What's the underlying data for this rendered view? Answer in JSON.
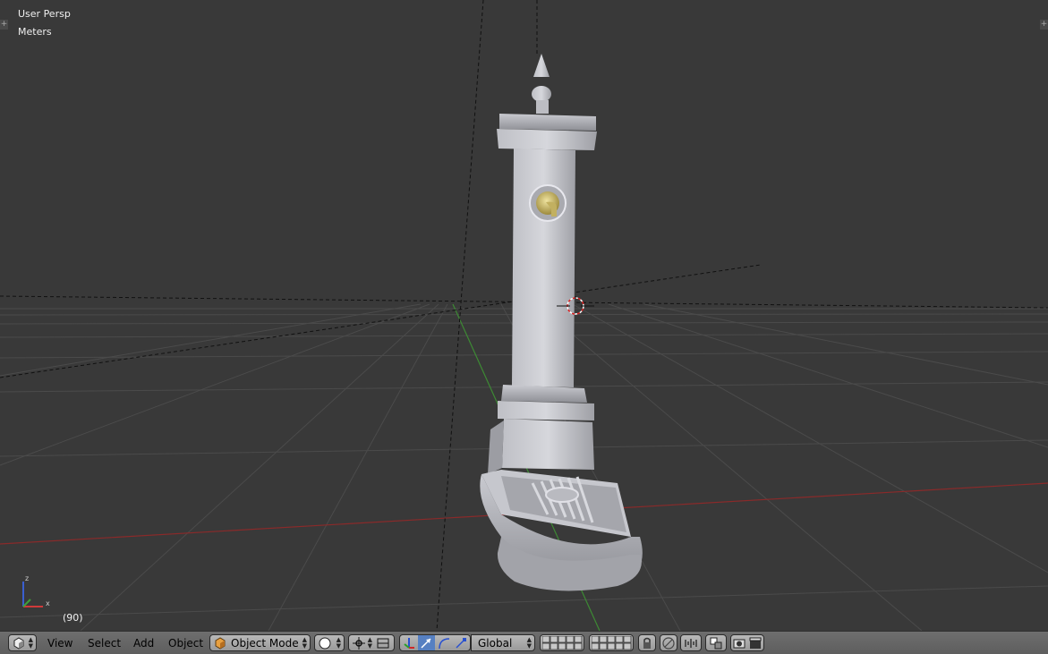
{
  "viewport": {
    "view_name": "User Persp",
    "units": "Meters",
    "frame": "(90)"
  },
  "header": {
    "editor_type_icon": "cube-view-icon",
    "menus": [
      "View",
      "Select",
      "Add",
      "Object"
    ],
    "mode": {
      "label": "Object Mode",
      "icon": "object-cube-icon"
    },
    "shading": {
      "icon": "solid-sphere-icon"
    },
    "pivot": {
      "icon": "pivot-point-icon"
    },
    "manipulator_icons": [
      "manipulator-toggle-icon",
      "translate-icon",
      "rotate-icon",
      "scale-icon"
    ],
    "orientation": {
      "label": "Global"
    },
    "layer_icons": [
      "layer-grid-icon",
      "layer-grid-icon"
    ],
    "right_icons": [
      "lock-camera-icon",
      "proportional-edit-icon",
      "snap-icon",
      "snap-target-icon",
      "render-icon",
      "render-animation-icon"
    ]
  },
  "colors": {
    "viewport_bg": "#393939",
    "grid": "#4c4c4c",
    "x_axis": "#8a2a2a",
    "y_axis": "#3d7d34",
    "header_bg": "#666666",
    "selected_button": "#5680c2"
  }
}
